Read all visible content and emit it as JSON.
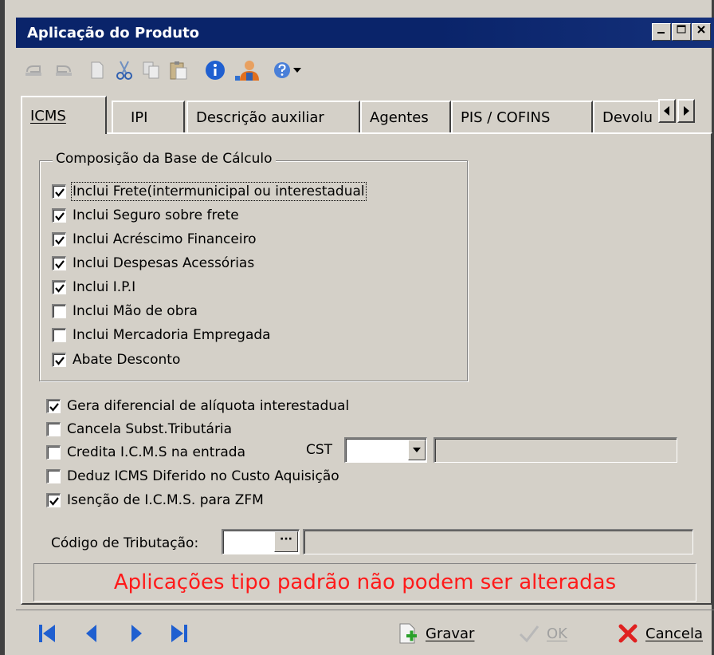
{
  "window": {
    "title": "Aplicação do Produto",
    "minimize": "_",
    "maximize": "□",
    "close": "×"
  },
  "tabs": [
    {
      "label": "ICMS",
      "active": true
    },
    {
      "label": "IPI",
      "active": false
    },
    {
      "label": "Descrição auxiliar",
      "active": false
    },
    {
      "label": "Agentes",
      "active": false
    },
    {
      "label": "PIS / COFINS",
      "active": false
    },
    {
      "label": "Devolu",
      "active": false
    }
  ],
  "group": {
    "legend": "Composição da Base de Cálculo",
    "items": [
      {
        "label": "Inclui Frete(intermunicipal ou interestadual",
        "checked": true
      },
      {
        "label": "Inclui Seguro sobre frete",
        "checked": true
      },
      {
        "label": "Inclui Acréscimo Financeiro",
        "checked": true
      },
      {
        "label": "Inclui Despesas Acessórias",
        "checked": true
      },
      {
        "label": "Inclui I.P.I",
        "checked": true
      },
      {
        "label": "Inclui Mão de obra",
        "checked": false
      },
      {
        "label": "Inclui Mercadoria Empregada",
        "checked": false
      },
      {
        "label": "Abate Desconto",
        "checked": true
      }
    ]
  },
  "options": [
    {
      "label": "Gera diferencial de alíquota interestadual",
      "checked": true
    },
    {
      "label": "Cancela Subst.Tributária",
      "checked": false
    },
    {
      "label": "Credita I.C.M.S na entrada",
      "checked": false
    },
    {
      "label": "Deduz ICMS Diferido no Custo Aquisição",
      "checked": false
    },
    {
      "label": "Isenção de I.C.M.S. para ZFM",
      "checked": true
    }
  ],
  "cst": {
    "label": "CST",
    "value": "",
    "description": ""
  },
  "codigo": {
    "label": "Código de Tributação:",
    "value": "",
    "button": "···",
    "description": ""
  },
  "message": "Aplicações tipo padrão não podem ser alteradas",
  "actions": {
    "save": "Gravar",
    "ok": "OK",
    "cancel": "Cancela"
  },
  "colors": {
    "titlebar": "#0a246a",
    "message": "#ff1a1a",
    "nav": "#1f5fd0"
  }
}
